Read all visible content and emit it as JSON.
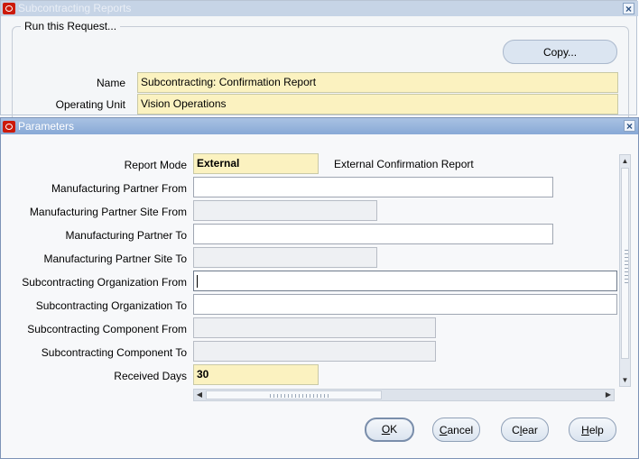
{
  "background_window": {
    "title": "Subcontracting Reports",
    "group_label": "Run this Request...",
    "copy_label": "Copy...",
    "name_label": "Name",
    "name_value": "Subcontracting: Confirmation Report",
    "operating_unit_label": "Operating Unit",
    "operating_unit_value": "Vision Operations",
    "close_glyph": "×"
  },
  "dialog": {
    "title": "Parameters",
    "close_glyph": "×",
    "fields": [
      {
        "label": "Report Mode",
        "value": "External",
        "description": "External Confirmation Report"
      },
      {
        "label": "Manufacturing Partner From",
        "value": ""
      },
      {
        "label": "Manufacturing Partner Site From",
        "value": ""
      },
      {
        "label": "Manufacturing Partner To",
        "value": ""
      },
      {
        "label": "Manufacturing Partner Site To",
        "value": ""
      },
      {
        "label": "Subcontracting Organization From",
        "value": ""
      },
      {
        "label": "Subcontracting Organization To",
        "value": ""
      },
      {
        "label": "Subcontracting Component From",
        "value": ""
      },
      {
        "label": "Subcontracting Component To",
        "value": ""
      },
      {
        "label": "Received Days",
        "value": "30"
      }
    ],
    "buttons": {
      "ok": {
        "mnemonic": "O",
        "rest": "K"
      },
      "cancel": {
        "mnemonic": "C",
        "rest": "ancel"
      },
      "clear": {
        "pre": "C",
        "mnemonic": "l",
        "rest": "ear"
      },
      "help": {
        "mnemonic": "H",
        "rest": "elp"
      }
    },
    "scroll_glyphs": {
      "up": "▲",
      "down": "▼",
      "left": "◀",
      "right": "▶"
    }
  },
  "colors": {
    "required_field": "#fbf2c0",
    "dialog_titlebar": "#88a9d6",
    "oracle_red": "#cc1a0a"
  }
}
